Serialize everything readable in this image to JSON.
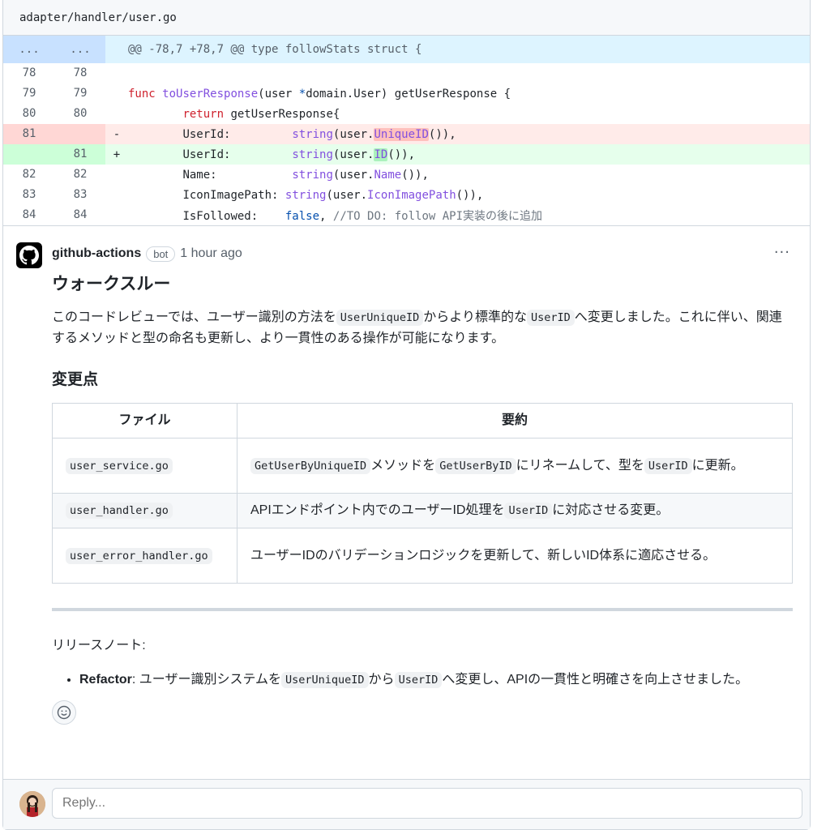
{
  "file": {
    "path": "adapter/handler/user.go"
  },
  "diff": {
    "hunk": {
      "left": "...",
      "right": "...",
      "text": "@@ -78,7 +78,7 @@ type followStats struct {"
    },
    "lines": [
      {
        "l": "78",
        "r": "78"
      },
      {
        "l": "79",
        "r": "79"
      },
      {
        "l": "80",
        "r": "80"
      },
      {
        "l": "81",
        "r": "",
        "mark": "-"
      },
      {
        "l": "",
        "r": "81",
        "mark": "+"
      },
      {
        "l": "82",
        "r": "82"
      },
      {
        "l": "83",
        "r": "83"
      },
      {
        "l": "84",
        "r": "84"
      }
    ],
    "code": {
      "l79_func": "func ",
      "l79_name": "toUserResponse",
      "l79_a": "(user ",
      "l79_ptr": "*",
      "l79_b": "domain.User) getUserResponse {",
      "l80_ret": "return",
      "l80_b": " getUserResponse{",
      "field_userid": "UserId:",
      "field_name": "Name:",
      "field_icon": "IconImagePath:",
      "field_followed": "IsFollowed:",
      "str": "string",
      "del_user": "(user.",
      "del_hl": "UniqueID",
      "del_end": "()),",
      "add_user": "(user.",
      "add_hl": "ID",
      "add_end": "()),",
      "name_user": "(user.",
      "name_fn": "Name",
      "name_end": "()),",
      "icon_user": "(user.",
      "icon_fn": "IconImagePath",
      "icon_end": "()),",
      "false": "false",
      "comma": ",",
      "comment": " //TO DO: follow API実装の後に追加"
    }
  },
  "comment": {
    "author": "github-actions",
    "badge": "bot",
    "time": "1 hour ago",
    "more": "···",
    "heading": "ウォークスルー",
    "p1_a": "このコードレビューでは、ユーザー識別の方法を",
    "p1_code1": "UserUniqueID",
    "p1_b": "からより標準的な",
    "p1_code2": "UserID",
    "p1_c": "へ変更しました。これに伴い、関連するメソッドと型の命名も更新し、より一貫性のある操作が可能になります。",
    "changes_heading": "変更点",
    "table": {
      "headers": [
        "ファイル",
        "要約"
      ],
      "rows": [
        {
          "file": "user_service.go",
          "s_code1": "GetUserByUniqueID",
          "s_a": "メソッドを",
          "s_code2": "GetUserByID",
          "s_b": "にリネームして、型を",
          "s_code3": "UserID",
          "s_c": "に更新。"
        },
        {
          "file": "user_handler.go",
          "s_a": "APIエンドポイント内でのユーザーID処理を",
          "s_code1": "UserID",
          "s_b": "に対応させる変更。"
        },
        {
          "file": "user_error_handler.go",
          "s_a": "ユーザーIDのバリデーションロジックを更新して、新しいID体系に適応させる。"
        }
      ]
    },
    "release_label": "リリースノート:",
    "bullet_strong": "Refactor",
    "bullet_a": ": ユーザー識別システムを",
    "bullet_code1": "UserUniqueID",
    "bullet_b": "から",
    "bullet_code2": "UserID",
    "bullet_c": "へ変更し、APIの一貫性と明確さを向上させました。"
  },
  "reply": {
    "placeholder": "Reply..."
  },
  "icons": {
    "bot_avatar": "github-mark-icon",
    "emoji": "smiley-icon"
  },
  "colors": {
    "del_bg": "#ffebe9",
    "add_bg": "#e6ffec",
    "hunk_bg": "#ddf4ff"
  }
}
